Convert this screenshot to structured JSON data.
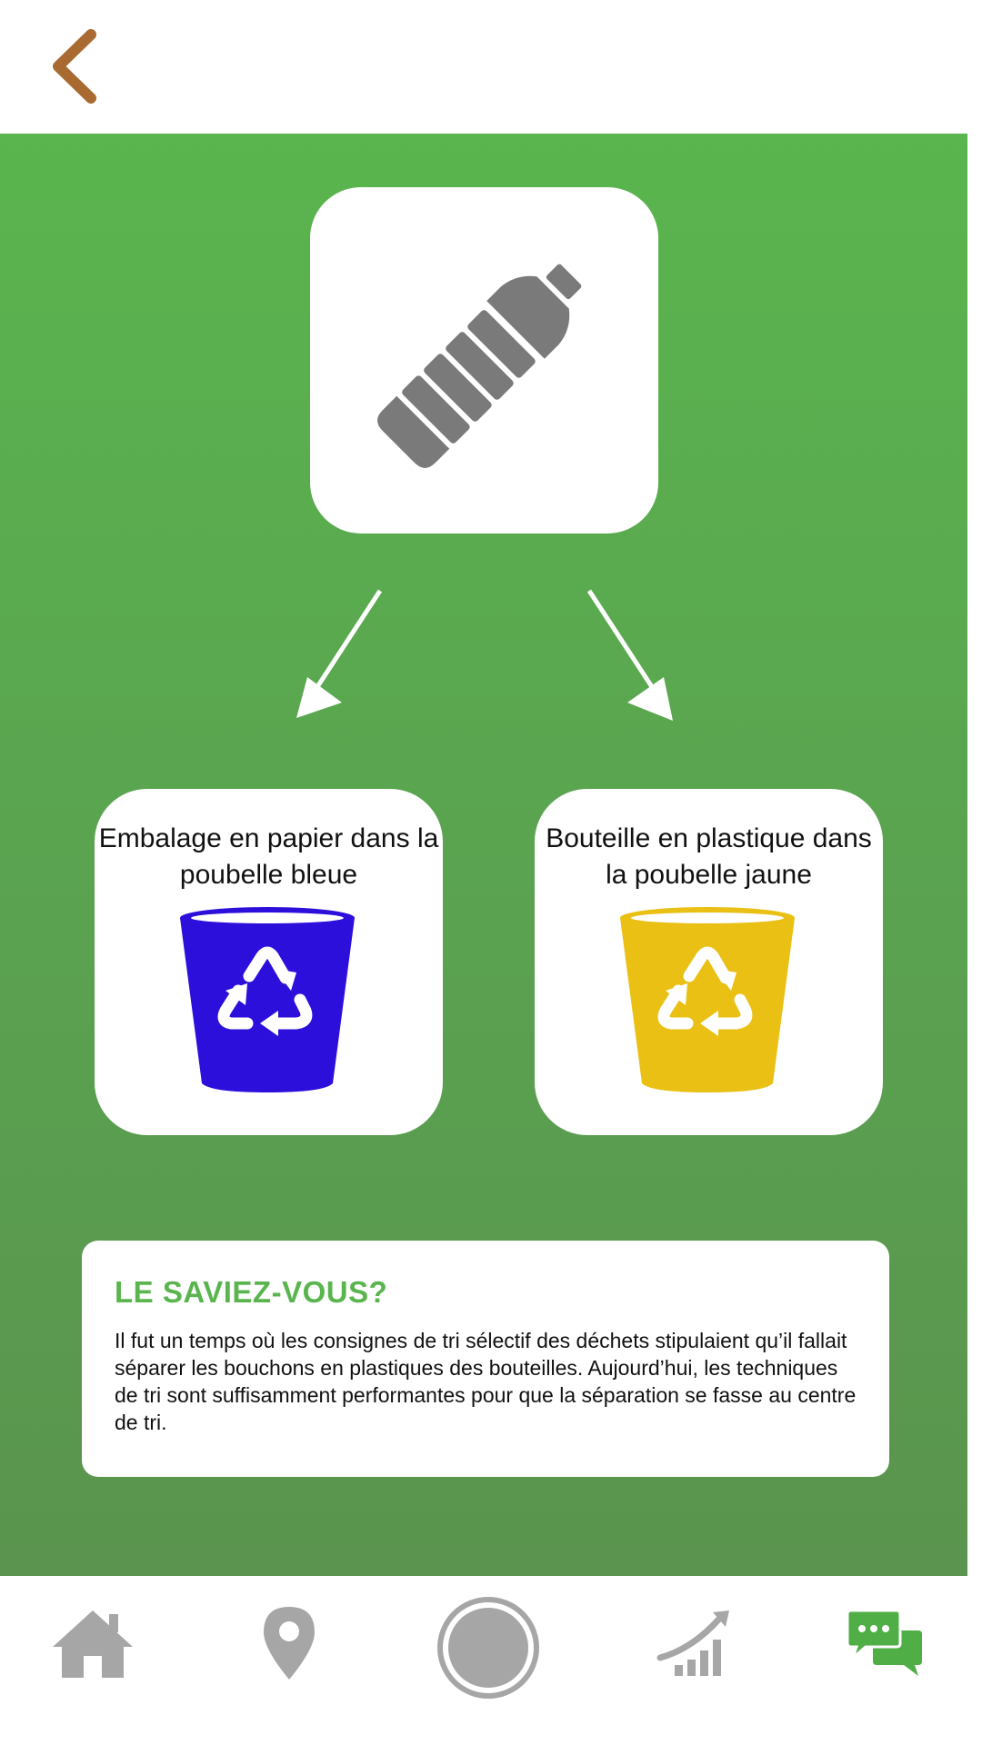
{
  "header": {
    "back_icon": "chevron-left-icon",
    "accent": "#a86a30"
  },
  "main": {
    "background": "#5ab54e",
    "item_icon": "plastic-bottle-icon",
    "bins": [
      {
        "label": "Embalage en papier dans la poubelle bleue",
        "color": "#2d0fdc",
        "icon": "recycle-bin-blue-icon"
      },
      {
        "label": "Bouteille en plastique dans la poubelle jaune",
        "color": "#e9c013",
        "icon": "recycle-bin-yellow-icon"
      }
    ],
    "info": {
      "title": "LE SAVIEZ-VOUS?",
      "body": "Il fut un temps où les consignes de tri sélectif des déchets stipulaient qu’il fallait séparer les bouchons en plastiques des bouteilles. Aujourd’hui, les techniques de tri sont suffisamment performantes pour que la séparation se fasse au centre de tri."
    }
  },
  "nav": {
    "items": [
      {
        "icon": "home-icon"
      },
      {
        "icon": "location-pin-icon"
      },
      {
        "icon": "scan-button-icon"
      },
      {
        "icon": "stats-chart-icon"
      },
      {
        "icon": "chat-icon",
        "active_color": "#5ab54e"
      }
    ]
  }
}
